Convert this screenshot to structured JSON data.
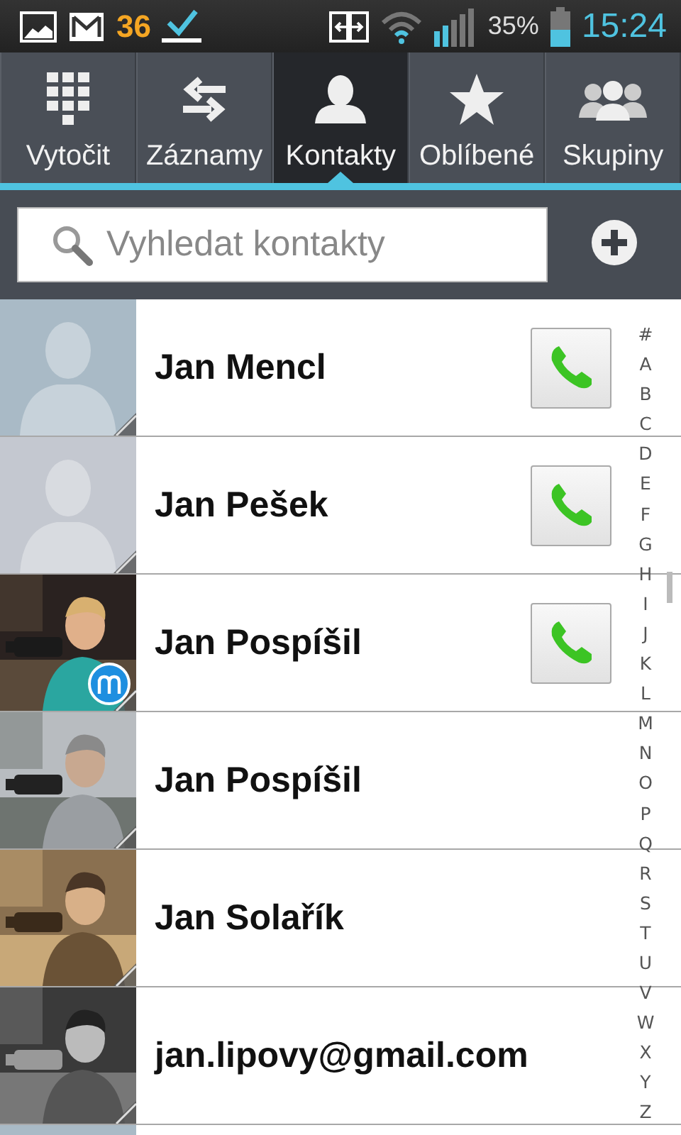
{
  "status_bar": {
    "notification_count": "36",
    "battery": "35%",
    "time": "15:24"
  },
  "tabs": [
    {
      "label": "Vytočit",
      "kind": "dialpad",
      "selected": false
    },
    {
      "label": "Záznamy",
      "kind": "log",
      "selected": false
    },
    {
      "label": "Kontakty",
      "kind": "contacts",
      "selected": true
    },
    {
      "label": "Oblíbené",
      "kind": "favorites",
      "selected": false
    },
    {
      "label": "Skupiny",
      "kind": "groups",
      "selected": false
    }
  ],
  "search": {
    "placeholder": "Vyhledat kontakty"
  },
  "contacts": [
    {
      "name": "Jan Mencl",
      "kind": "silhouette",
      "call_button": true,
      "badge": false
    },
    {
      "name": "Jan Pešek",
      "kind": "silhouette",
      "call_button": true,
      "badge": false
    },
    {
      "name": "Jan Pospíšil",
      "kind": "picture",
      "call_button": true,
      "badge": true
    },
    {
      "name": "Jan Pospíšil",
      "kind": "picture",
      "call_button": false,
      "badge": false
    },
    {
      "name": "Jan Solařík",
      "kind": "picture",
      "call_button": false,
      "badge": false
    },
    {
      "name": "jan.lipovy@gmail.com",
      "kind": "picture",
      "call_button": false,
      "badge": false
    }
  ],
  "index": [
    "#",
    "A",
    "B",
    "C",
    "D",
    "E",
    "F",
    "G",
    "H",
    "I",
    "J",
    "K",
    "L",
    "M",
    "N",
    "O",
    "P",
    "Q",
    "R",
    "S",
    "T",
    "U",
    "V",
    "W",
    "X",
    "Y",
    "Z"
  ]
}
